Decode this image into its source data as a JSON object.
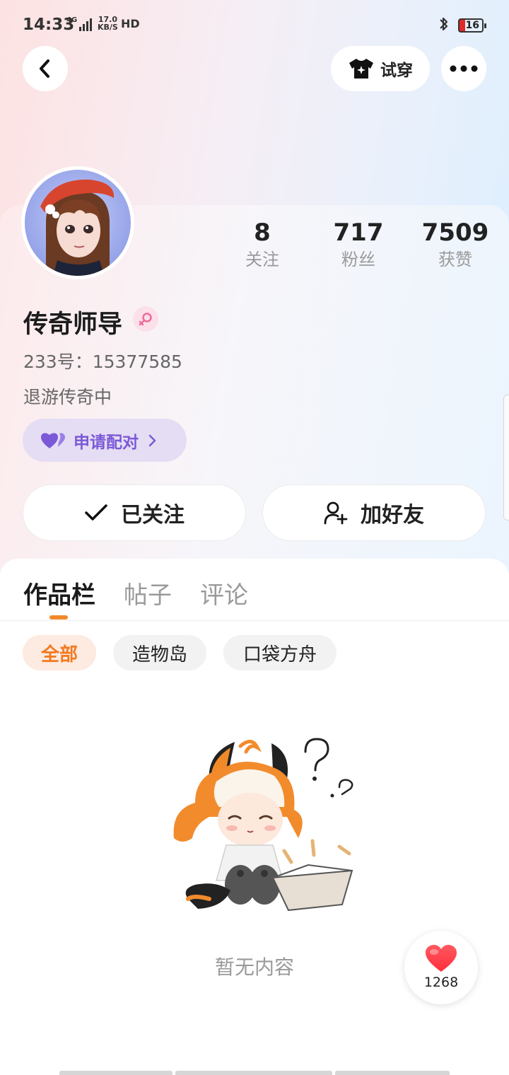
{
  "status_bar": {
    "time": "14:33",
    "network": "4G",
    "speed_value": "17.0",
    "speed_unit": "KB/S",
    "hd": "HD",
    "battery": "16"
  },
  "top_bar": {
    "try_on_label": "试穿"
  },
  "profile": {
    "stats": [
      {
        "value": "8",
        "label": "关注"
      },
      {
        "value": "717",
        "label": "粉丝"
      },
      {
        "value": "7509",
        "label": "获赞"
      }
    ],
    "username": "传奇师导",
    "id_text": "233号：15377585",
    "bio": "退游传奇中",
    "pair_label": "申请配对",
    "follow_label": "已关注",
    "add_friend_label": "加好友"
  },
  "tabs": [
    {
      "label": "作品栏",
      "active": true
    },
    {
      "label": "帖子",
      "active": false
    },
    {
      "label": "评论",
      "active": false
    }
  ],
  "filters": [
    {
      "label": "全部",
      "active": true
    },
    {
      "label": "造物岛",
      "active": false
    },
    {
      "label": "口袋方舟",
      "active": false
    }
  ],
  "empty_state": {
    "text": "暂无内容"
  },
  "like_button": {
    "count": "1268"
  },
  "colors": {
    "accent_orange": "#f27a21",
    "pair_purple": "#7b59d6",
    "like_red": "#ff3b4a"
  }
}
